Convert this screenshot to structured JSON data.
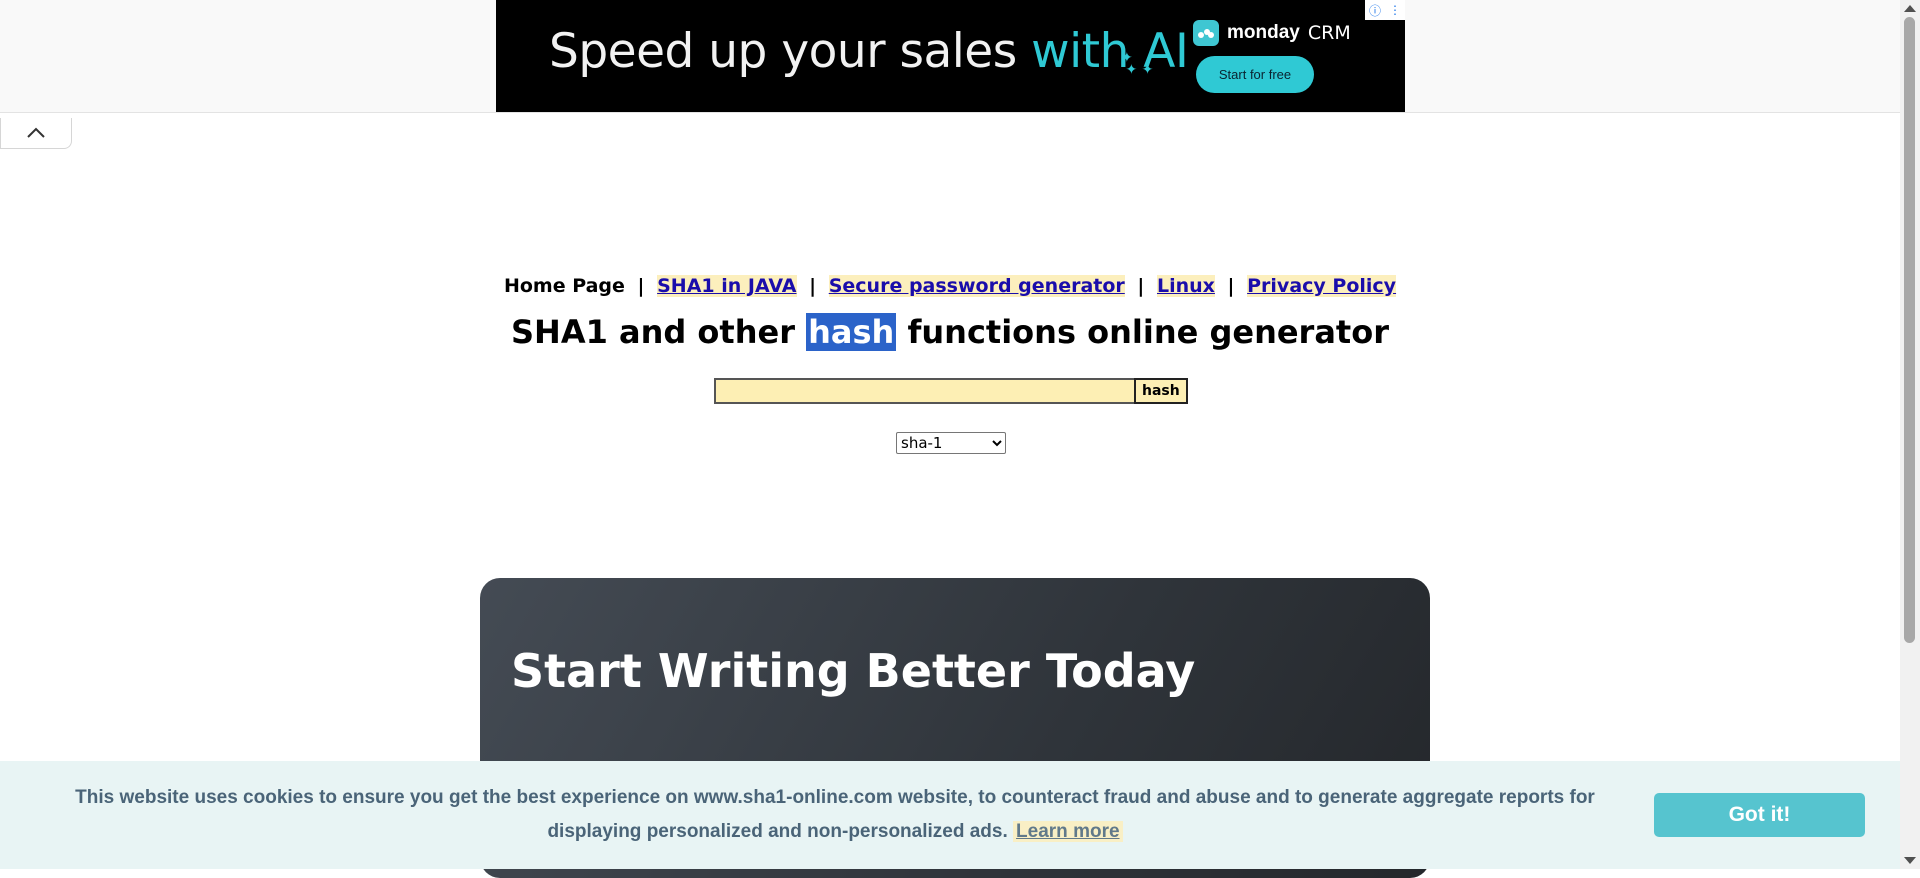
{
  "ad": {
    "headline_part1": "Speed up your sales ",
    "headline_part2": "with AI",
    "brand_name": "monday",
    "brand_suffix": "CRM",
    "cta_label": "Start for free",
    "info_icon": "info-icon",
    "menu_icon": "kebab-menu-icon",
    "colors": {
      "background": "#000000",
      "accent": "#2fc9d4"
    }
  },
  "collapse_tab": {
    "icon": "chevron-up-icon"
  },
  "nav": {
    "home": "Home Page",
    "separator": "|",
    "links": [
      {
        "label": "SHA1 in JAVA"
      },
      {
        "label": "Secure password generator"
      },
      {
        "label": "Linux"
      },
      {
        "label": "Privacy Policy"
      }
    ]
  },
  "page_title": {
    "before": "SHA1 and other ",
    "highlight": "hash",
    "after": " functions online generator"
  },
  "hash_form": {
    "input_value": "",
    "button_label": "hash"
  },
  "algorithm_select": {
    "selected": "sha-1"
  },
  "promo": {
    "heading": "Start Writing Better Today"
  },
  "cookie_banner": {
    "message": "This website uses cookies to ensure you get the best experience on www.sha1-online.com website, to counteract fraud and abuse and to generate aggregate reports for displaying personalized and non-personalized ads.",
    "learn_more": "Learn more",
    "accept_label": "Got it!",
    "colors": {
      "background": "#e8f4f4",
      "text": "#4a6478",
      "button": "#56c4cf"
    }
  }
}
